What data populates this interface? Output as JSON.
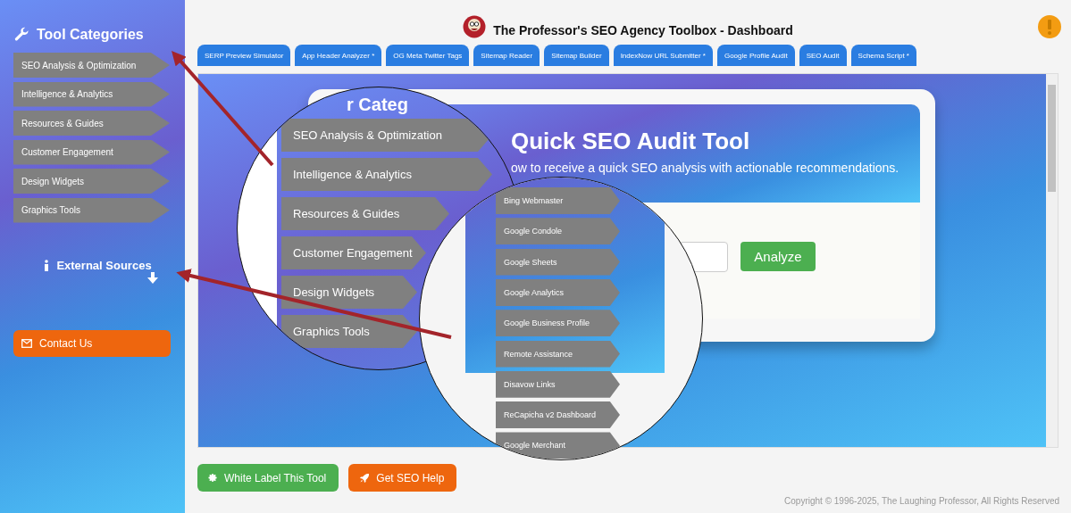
{
  "sidebar": {
    "heading": "Tool Categories",
    "categories": [
      {
        "label": "SEO Analysis & Optimization"
      },
      {
        "label": "Intelligence & Analytics"
      },
      {
        "label": "Resources & Guides"
      },
      {
        "label": "Customer Engagement"
      },
      {
        "label": "Design Widgets"
      },
      {
        "label": "Graphics Tools"
      }
    ],
    "external_heading": "External Sources",
    "contact_button": "Contact Us"
  },
  "header": {
    "title": "The Professor's SEO Agency Toolbox - Dashboard"
  },
  "tabs": [
    {
      "label": "SERP Preview Simulator",
      "selected": false
    },
    {
      "label": "App Header Analyzer *",
      "selected": false
    },
    {
      "label": "OG Meta Twitter Tags",
      "selected": false
    },
    {
      "label": "Sitemap Reader",
      "selected": false
    },
    {
      "label": "Sitemap Builder",
      "selected": false
    },
    {
      "label": "IndexNow URL Submitter *",
      "selected": false
    },
    {
      "label": "Google Profile Audit",
      "selected": false
    },
    {
      "label": "SEO Audit",
      "selected": false
    },
    {
      "label": "Schema Script *",
      "selected": false
    }
  ],
  "tool_card": {
    "title": "Quick SEO Audit Tool",
    "subtitle": "ow to receive a quick SEO analysis with actionable recommendations.",
    "analyze_button": "Analyze"
  },
  "magnifier_categories": {
    "heading_fragment": "r Categ",
    "items": [
      {
        "label": "SEO Analysis & Optimization"
      },
      {
        "label": "Intelligence & Analytics"
      },
      {
        "label": "Resources & Guides"
      },
      {
        "label": "Customer Engagement"
      },
      {
        "label": "Design Widgets"
      },
      {
        "label": "Graphics Tools"
      }
    ]
  },
  "magnifier_sources": {
    "items": [
      {
        "label": "Bing Webmaster"
      },
      {
        "label": "Google Condole"
      },
      {
        "label": "Google Sheets"
      },
      {
        "label": "Google Analytics"
      },
      {
        "label": "Google Business Profile"
      },
      {
        "label": "Remote Assistance"
      },
      {
        "label": "Disavow Links"
      },
      {
        "label": "ReCapicha v2 Dashboard"
      },
      {
        "label": "Google Merchant"
      }
    ]
  },
  "footer": {
    "buttons": [
      {
        "label": "White Label This Tool",
        "kind": "white-label"
      },
      {
        "label": "Get SEO Help",
        "kind": "help"
      }
    ],
    "copyright": "Copyright © 1996-2025, The Laughing Professor, All Rights Reserved"
  }
}
